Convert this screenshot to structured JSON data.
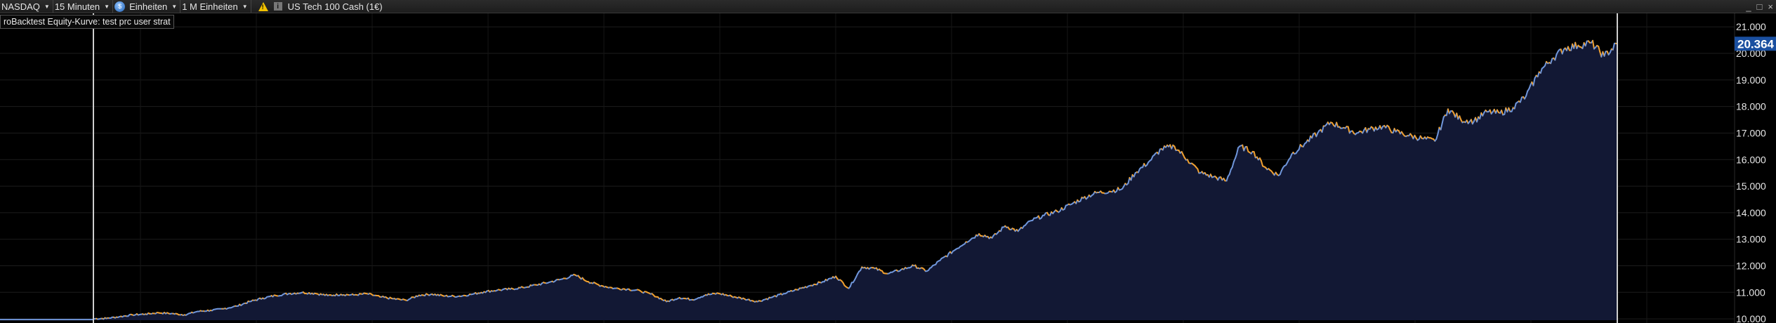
{
  "toolbar": {
    "market": "NASDAQ",
    "interval": "15 Minuten",
    "units": "Einheiten",
    "position_size": "1 M Einheiten",
    "instrument": "US Tech 100 Cash (1€)"
  },
  "window_controls": [
    "_",
    "□",
    "×"
  ],
  "legend": "roBacktest Equity-Kurve: test prc user strat",
  "colors": {
    "background": "#000000",
    "rising": "#6f95d9",
    "falling": "#f0a030",
    "fill": "#121834",
    "price_tag": "#1a4fa0",
    "cursor": "#cfcfcf"
  },
  "chart_data": {
    "type": "area",
    "y_axis_side": "right",
    "ylim": [
      9950,
      21350
    ],
    "y_ticks": [
      10000,
      11000,
      12000,
      13000,
      14000,
      15000,
      16000,
      17000,
      18000,
      19000,
      20000,
      21000
    ],
    "y_tick_labels": [
      "10.000",
      "11.000",
      "12.000",
      "13.000",
      "14.000",
      "15.000",
      "16.000",
      "17.000",
      "18.000",
      "19.000",
      "20.000",
      "21.000"
    ],
    "current_value": 20364,
    "current_value_label": "20.364",
    "series": [
      {
        "values": [
          10000,
          10020,
          10080,
          10150,
          10180,
          10230,
          10200,
          10150,
          10280,
          10320,
          10380,
          10480,
          10650,
          10780,
          10880,
          10950,
          10990,
          10960,
          10880,
          10920,
          10900,
          10950,
          10830,
          10760,
          10700,
          10890,
          10930,
          10860,
          10850,
          10920,
          11020,
          11080,
          11120,
          11180,
          11280,
          11380,
          11500,
          11650,
          11400,
          11250,
          11150,
          11120,
          11050,
          10900,
          10650,
          10800,
          10720,
          10900,
          10960,
          10850,
          10750,
          10650,
          10800,
          10950,
          11100,
          11250,
          11400,
          11600,
          11150,
          11950,
          11900,
          11700,
          11850,
          12000,
          11800,
          12200,
          12550,
          12900,
          13200,
          13050,
          13500,
          13300,
          13700,
          13900,
          14050,
          14300,
          14550,
          14750,
          14800,
          14900,
          15500,
          15900,
          16400,
          16500,
          16000,
          15500,
          15350,
          15200,
          16500,
          16300,
          15700,
          15400,
          16200,
          16600,
          17000,
          17400,
          17200,
          17000,
          17150,
          17250,
          17050,
          16900,
          16800,
          16700,
          17900,
          17500,
          17450,
          17800,
          17750,
          17950,
          18400,
          19300,
          19800,
          20200,
          20300,
          20400,
          19900,
          20364
        ]
      }
    ]
  }
}
